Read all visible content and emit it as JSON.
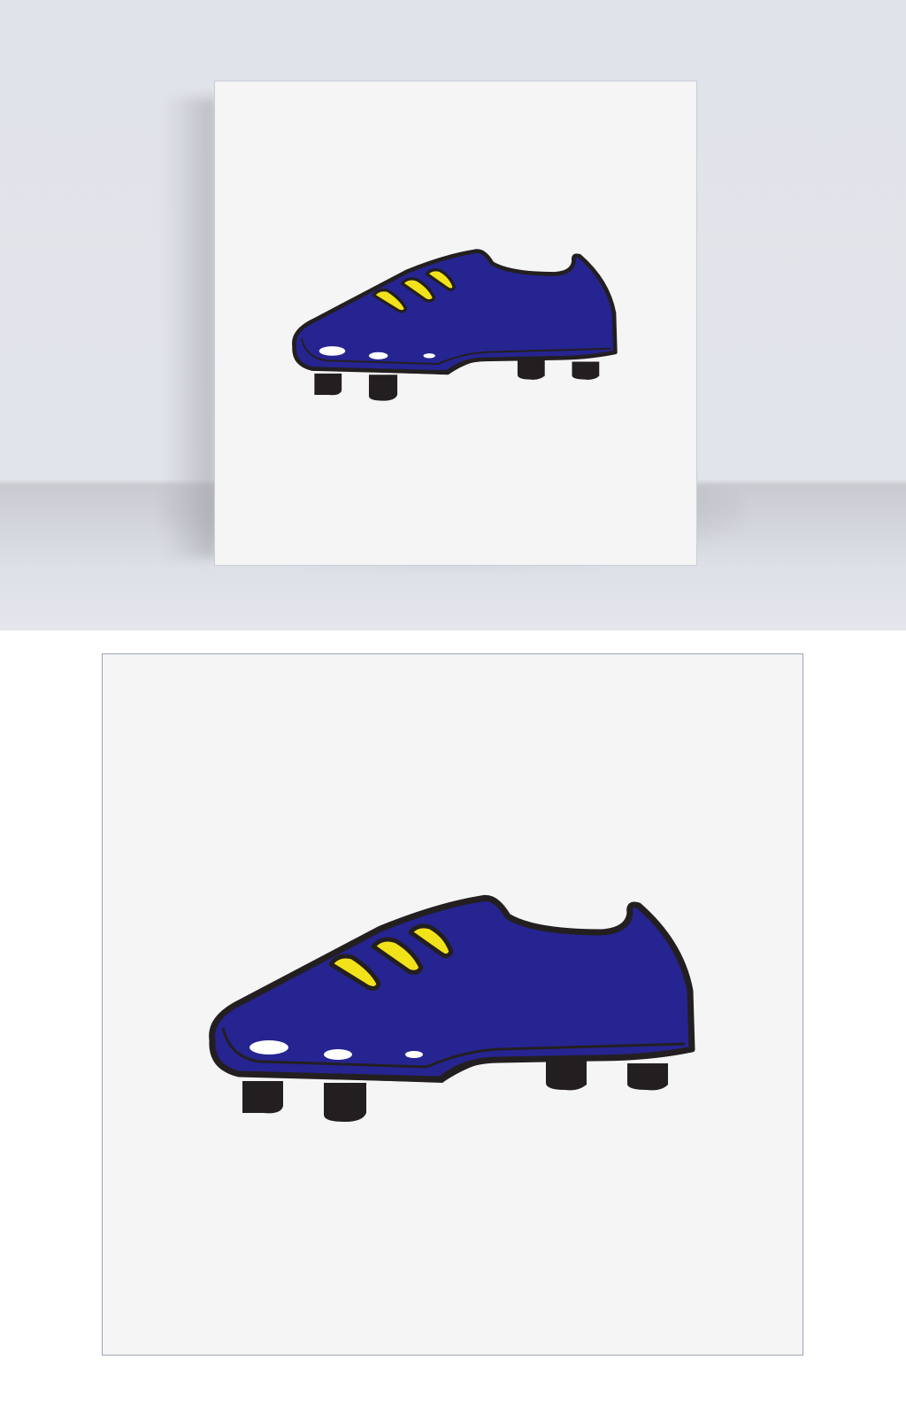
{
  "colors": {
    "background_wall": "#e2e4eb",
    "card": "#f5f5f5",
    "shoe_upper": "#262491",
    "shoe_outline": "#231f20",
    "laces": "#f2e21a",
    "highlights": "#ffffff",
    "studs": "#231f20"
  },
  "icons": {
    "top_image": "football-boot-icon",
    "bottom_image": "football-boot-icon"
  }
}
